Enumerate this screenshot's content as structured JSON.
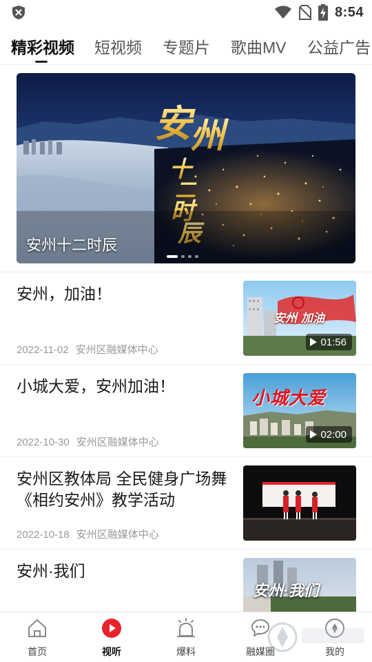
{
  "status_bar": {
    "time": "8:54",
    "icons": [
      "shield-icon",
      "wifi-icon",
      "no-sim-icon",
      "battery-charging-icon"
    ]
  },
  "tabs": [
    {
      "label": "精彩视频",
      "active": true
    },
    {
      "label": "短视频",
      "active": false
    },
    {
      "label": "专题片",
      "active": false
    },
    {
      "label": "歌曲MV",
      "active": false
    },
    {
      "label": "公益广告",
      "active": false
    }
  ],
  "banner": {
    "caption": "安州十二时辰",
    "artwork_title": "安州十二时辰",
    "slide_count": 4,
    "active_slide": 1
  },
  "news": [
    {
      "title": "安州，加油！",
      "date": "2022-11-02",
      "source": "安州区融媒体中心",
      "duration": "01:56",
      "thumb_text": "安州 加油"
    },
    {
      "title": "小城大爱，安州加油！",
      "date": "2022-10-30",
      "source": "安州区融媒体中心",
      "duration": "02:00",
      "thumb_text": "小城大爱"
    },
    {
      "title": "安州区教体局 全民健身广场舞《相约安州》教学活动",
      "date": "2022-10-18",
      "source": "安州区融媒体中心",
      "duration": "",
      "thumb_text": ""
    },
    {
      "title": "安州·我们",
      "date": "",
      "source": "",
      "duration": "",
      "thumb_text": "安州·我们"
    }
  ],
  "bottom_nav": [
    {
      "label": "首页",
      "icon": "home-icon",
      "active": false
    },
    {
      "label": "视听",
      "icon": "play-circle-icon",
      "active": true
    },
    {
      "label": "爆料",
      "icon": "alarm-siren-icon",
      "active": false
    },
    {
      "label": "融媒圈",
      "icon": "chat-bubble-icon",
      "active": false
    },
    {
      "label": "我的",
      "icon": "profile-icon",
      "active": false
    }
  ],
  "colors": {
    "accent_red": "#e8232b",
    "meta_gray": "#999999",
    "divider": "#eeeeee"
  }
}
